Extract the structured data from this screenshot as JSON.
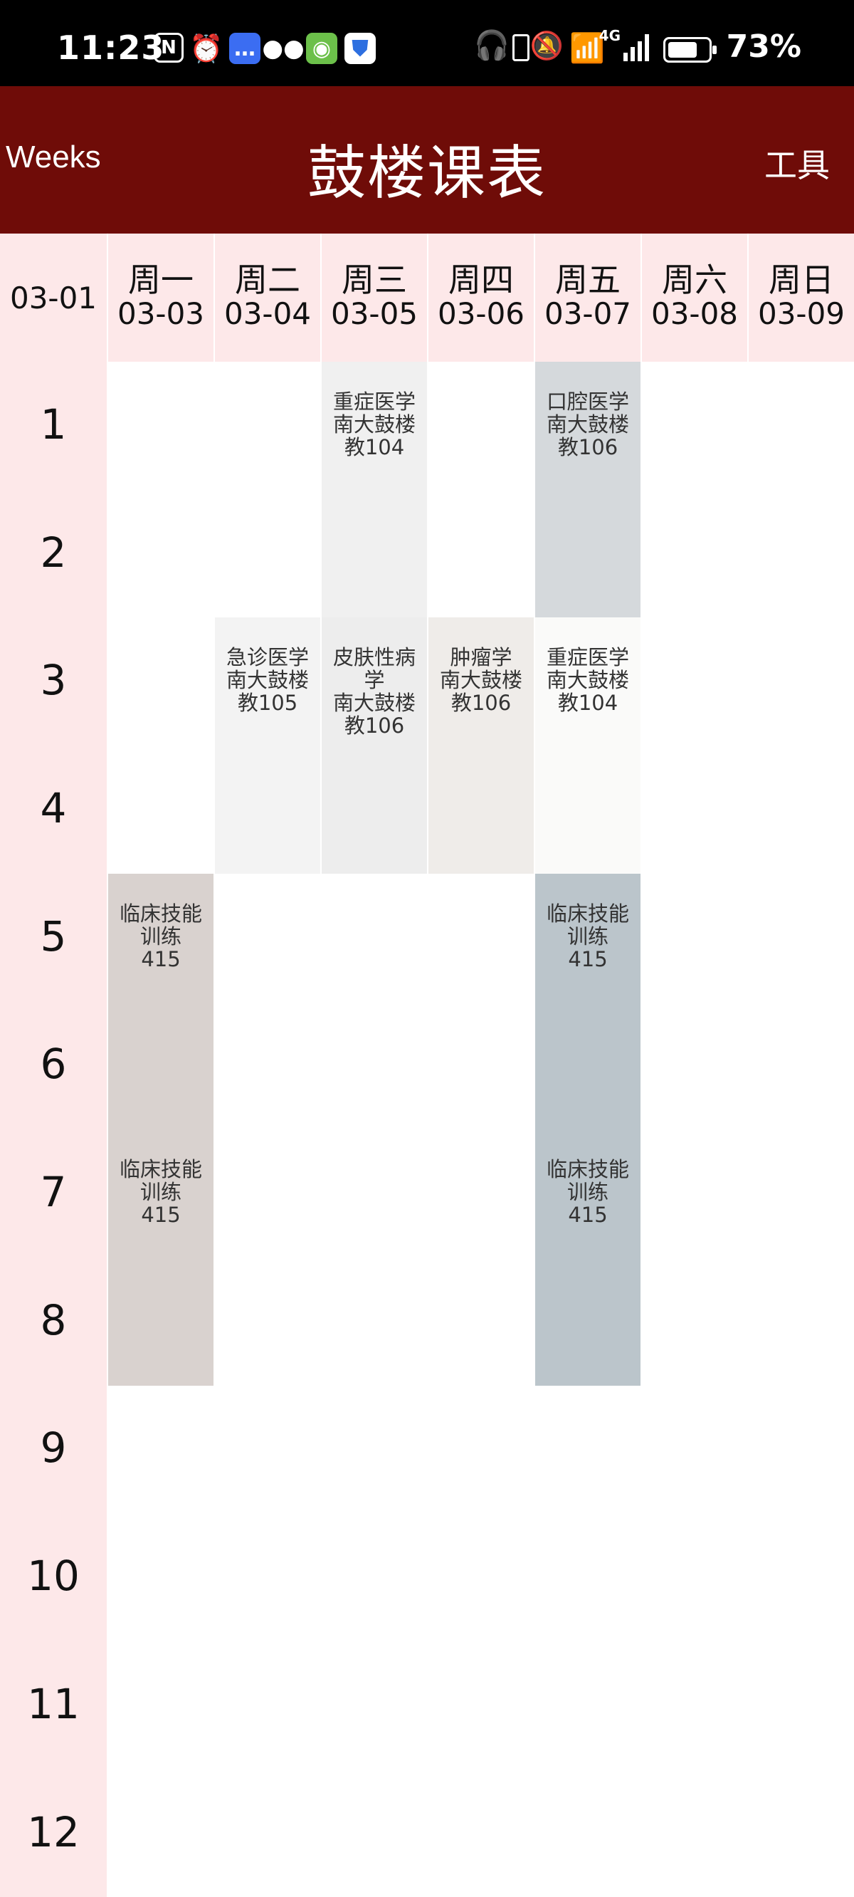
{
  "status_bar": {
    "time": "11:23",
    "battery_percent": "73%",
    "network": "4G",
    "app_icons": [
      "nfc-icon",
      "alarm-icon",
      "message-icon",
      "wechat-icon",
      "app-icon",
      "shield-icon"
    ]
  },
  "header": {
    "weeks_label": "Weeks",
    "title": "鼓楼课表",
    "tools_label": "工具",
    "background": "#6f0c08"
  },
  "week_start": "03-01",
  "days": [
    {
      "name": "周一",
      "date": "03-03"
    },
    {
      "name": "周二",
      "date": "03-04"
    },
    {
      "name": "周三",
      "date": "03-05"
    },
    {
      "name": "周四",
      "date": "03-06"
    },
    {
      "name": "周五",
      "date": "03-07"
    },
    {
      "name": "周六",
      "date": "03-08"
    },
    {
      "name": "周日",
      "date": "03-09"
    }
  ],
  "slots": [
    "1",
    "2",
    "3",
    "4",
    "5",
    "6",
    "7",
    "8",
    "9",
    "10",
    "11",
    "12"
  ],
  "courses": [
    {
      "day": 3,
      "start": 1,
      "end": 2,
      "name": "重症医学",
      "location": "南大鼓楼",
      "room": "教104",
      "color": "#f0f0f0"
    },
    {
      "day": 5,
      "start": 1,
      "end": 2,
      "name": "口腔医学",
      "location": "南大鼓楼",
      "room": "教106",
      "color": "#d5d9dc"
    },
    {
      "day": 2,
      "start": 3,
      "end": 4,
      "name": "急诊医学",
      "location": "南大鼓楼",
      "room": "教105",
      "color": "#f3f3f3"
    },
    {
      "day": 3,
      "start": 3,
      "end": 4,
      "name": "皮肤性病学",
      "location": "南大鼓楼",
      "room": "教106",
      "color": "#ededed"
    },
    {
      "day": 4,
      "start": 3,
      "end": 4,
      "name": "肿瘤学",
      "location": "南大鼓楼",
      "room": "教106",
      "color": "#efece9"
    },
    {
      "day": 5,
      "start": 3,
      "end": 4,
      "name": "重症医学",
      "location": "南大鼓楼",
      "room": "教104",
      "color": "#fafaf9"
    },
    {
      "day": 1,
      "start": 5,
      "end": 6,
      "name": "临床技能训练",
      "location": "",
      "room": "415",
      "color": "#d9d2cf"
    },
    {
      "day": 1,
      "start": 7,
      "end": 8,
      "name": "临床技能训练",
      "location": "",
      "room": "415",
      "color": "#d9d2cf"
    },
    {
      "day": 5,
      "start": 5,
      "end": 6,
      "name": "临床技能训练",
      "location": "",
      "room": "415",
      "color": "#bbc5cb"
    },
    {
      "day": 5,
      "start": 7,
      "end": 8,
      "name": "临床技能训练",
      "location": "",
      "room": "415",
      "color": "#bbc5cb"
    }
  ]
}
